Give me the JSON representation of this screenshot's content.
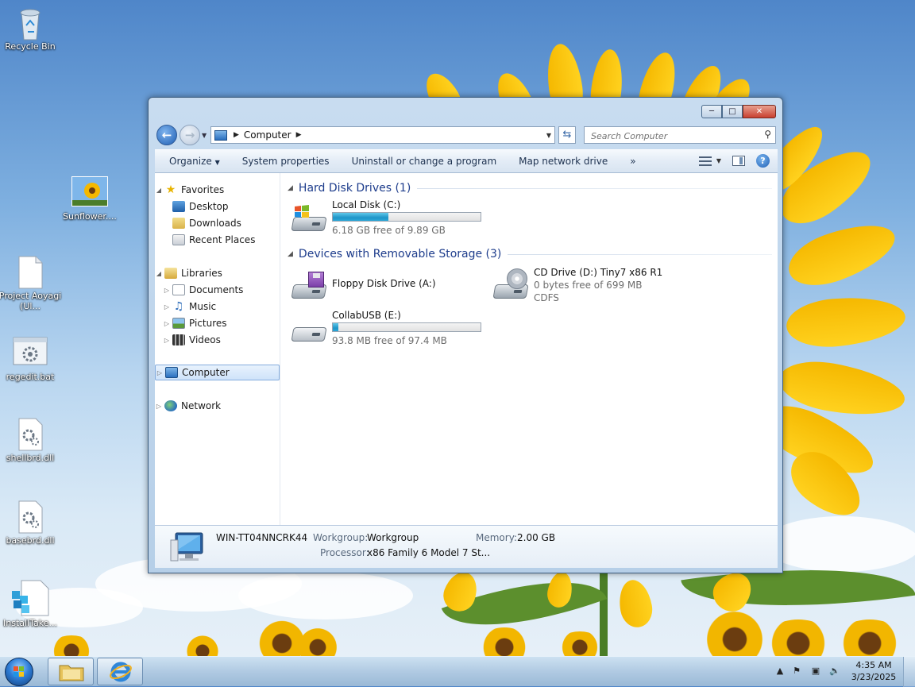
{
  "desktop": {
    "icons": [
      {
        "label": "Recycle Bin",
        "icon": "recycle-bin-icon"
      },
      {
        "label": "Sunflower....",
        "icon": "image-file-icon"
      },
      {
        "label": "Project Aoyagi (Ul...",
        "icon": "document-icon"
      },
      {
        "label": "regedit.bat",
        "icon": "batch-file-icon"
      },
      {
        "label": "shellbrd.dll",
        "icon": "dll-file-icon"
      },
      {
        "label": "basebrd.dll",
        "icon": "dll-file-icon"
      },
      {
        "label": "InstallTake...",
        "icon": "registry-file-icon"
      }
    ]
  },
  "window": {
    "controls": {
      "minimize": "minimize",
      "maximize": "maximize",
      "close": "close"
    },
    "address": {
      "crumb": "Computer"
    },
    "search": {
      "placeholder": "Search Computer"
    },
    "toolbar": {
      "organize": "Organize",
      "system_properties": "System properties",
      "uninstall": "Uninstall or change a program",
      "map_drive": "Map network drive",
      "more": "»"
    },
    "nav": {
      "favorites": "Favorites",
      "desktop": "Desktop",
      "downloads": "Downloads",
      "recent": "Recent Places",
      "libraries": "Libraries",
      "documents": "Documents",
      "music": "Music",
      "pictures": "Pictures",
      "videos": "Videos",
      "computer": "Computer",
      "network": "Network"
    },
    "groups": {
      "hdd": "Hard Disk Drives (1)",
      "removable": "Devices with Removable Storage (3)"
    },
    "drives": {
      "c": {
        "name": "Local Disk (C:)",
        "free": "6.18 GB free of 9.89 GB",
        "used_fraction": 0.375
      },
      "a": {
        "name": "Floppy Disk Drive (A:)"
      },
      "d": {
        "name": "CD Drive (D:) Tiny7 x86 R1",
        "free": "0 bytes free of 699 MB",
        "fs": "CDFS"
      },
      "e": {
        "name": "CollabUSB (E:)",
        "free": "93.8 MB free of 97.4 MB",
        "used_fraction": 0.037
      }
    },
    "details": {
      "pc_name": "WIN-TT04NNCRK44",
      "workgroup_label": "Workgroup:",
      "workgroup": "Workgroup",
      "memory_label": "Memory:",
      "memory": "2.00 GB",
      "processor_label": "Processor:",
      "processor": "x86 Family 6 Model 7 St..."
    }
  },
  "taskbar": {
    "time": "4:35 AM",
    "date": "3/23/2025"
  },
  "colors": {
    "group_header": "#1e3d8c",
    "progress_fill": "#1f96c8",
    "accent": "#2f7ed8"
  }
}
